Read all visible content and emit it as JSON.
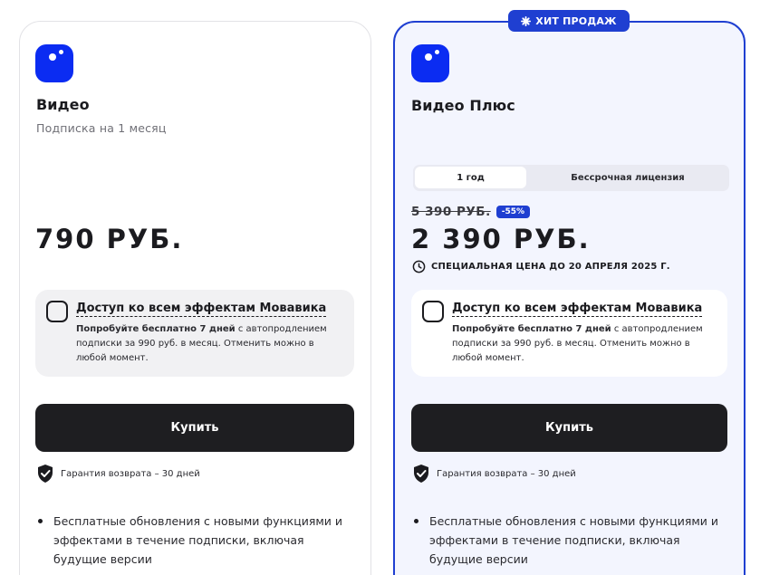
{
  "badge": {
    "icon": "star-burst-icon",
    "label": "ХИТ ПРОДАЖ"
  },
  "plans": {
    "basic": {
      "title": "Видео",
      "subtitle": "Подписка на 1 месяц",
      "price": "790 РУБ.",
      "addon": {
        "title": "Доступ ко всем эффектам Мовавика",
        "desc_bold": "Попробуйте бесплатно 7 дней",
        "desc_rest": " с автопродлением подписки за 990 руб. в месяц. Отменить можно в любой момент."
      },
      "buy_label": "Купить",
      "guarantee": "Гарантия возврата – 30 дней",
      "features": [
        "Бесплатные обновления с новыми функциями и эффектами в течение подписки, включая будущие версии"
      ]
    },
    "plus": {
      "title": "Видео Плюс",
      "tabs": [
        {
          "label": "1 год",
          "selected": true
        },
        {
          "label": "Бессрочная лицензия",
          "selected": false
        }
      ],
      "old_price": "5 390 РУБ.",
      "discount": "-55%",
      "price": "2 390 РУБ.",
      "special_offer": "СПЕЦИАЛЬНАЯ ЦЕНА ДО 20 АПРЕЛЯ 2025 Г.",
      "addon": {
        "title": "Доступ ко всем эффектам Мовавика",
        "desc_bold": "Попробуйте бесплатно 7 дней",
        "desc_rest": " с автопродлением подписки за 990 руб. в месяц. Отменить можно в любой момент."
      },
      "buy_label": "Купить",
      "guarantee": "Гарантия возврата – 30 дней",
      "features": [
        "Бесплатные обновления с новыми функциями и эффектами в течение подписки, включая будущие версии"
      ]
    }
  },
  "colors": {
    "accent": "#1f3fd1",
    "logo": "#0b2cf2",
    "button": "#1e1e21",
    "plus_bg": "#f3f5fe"
  }
}
